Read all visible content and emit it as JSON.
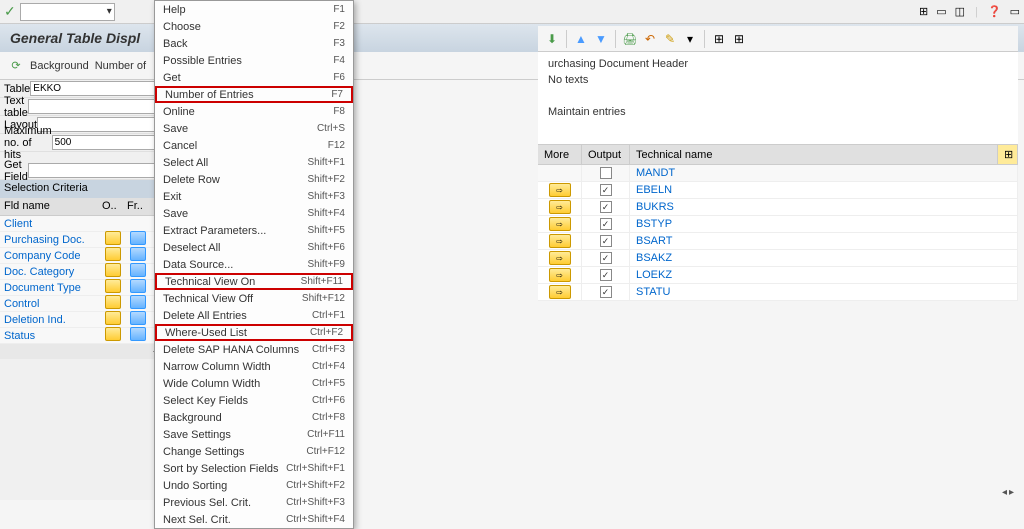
{
  "top": {
    "check": "✓"
  },
  "title": "General Table Displ",
  "sub_toolbar": {
    "icon": "⟳",
    "background": "Background",
    "num_entries": "Number of"
  },
  "left_form": {
    "table_label": "Table",
    "table_value": "EKKO",
    "texttable_label": "Text table",
    "texttable_value": "",
    "layout_label": "Layout",
    "layout_value": "",
    "maxhits_label": "Maximum no. of hits",
    "maxhits_value": "500",
    "getfield_label": "Get Field",
    "getfield_value": ""
  },
  "criteria": {
    "header": "Selection Criteria",
    "col_name": "Fld name",
    "col_o": "O..",
    "col_fr": "Fr..",
    "rows": [
      {
        "name": "Client"
      },
      {
        "name": "Purchasing Doc."
      },
      {
        "name": "Company Code"
      },
      {
        "name": "Doc. Category"
      },
      {
        "name": "Document Type"
      },
      {
        "name": "Control"
      },
      {
        "name": "Deletion Ind."
      },
      {
        "name": "Status"
      }
    ]
  },
  "menu": {
    "items": [
      {
        "label": "Help",
        "shortcut": "F1"
      },
      {
        "label": "Choose",
        "shortcut": "F2"
      },
      {
        "label": "Back",
        "shortcut": "F3"
      },
      {
        "label": "Possible Entries",
        "shortcut": "F4"
      },
      {
        "label": "Get",
        "shortcut": "F6"
      },
      {
        "label": "Number of Entries",
        "shortcut": "F7",
        "hl": true
      },
      {
        "label": "Online",
        "shortcut": "F8"
      },
      {
        "label": "Save",
        "shortcut": "Ctrl+S"
      },
      {
        "label": "Cancel",
        "shortcut": "F12"
      },
      {
        "label": "Select All",
        "shortcut": "Shift+F1"
      },
      {
        "label": "Delete Row",
        "shortcut": "Shift+F2"
      },
      {
        "label": "Exit",
        "shortcut": "Shift+F3"
      },
      {
        "label": "Save",
        "shortcut": "Shift+F4"
      },
      {
        "label": "Extract Parameters...",
        "shortcut": "Shift+F5"
      },
      {
        "label": "Deselect All",
        "shortcut": "Shift+F6"
      },
      {
        "label": "Data Source...",
        "shortcut": "Shift+F9"
      },
      {
        "label": "Technical View On",
        "shortcut": "Shift+F11",
        "hl": true
      },
      {
        "label": "Technical View Off",
        "shortcut": "Shift+F12"
      },
      {
        "label": "Delete All Entries",
        "shortcut": "Ctrl+F1"
      },
      {
        "label": "Where-Used List",
        "shortcut": "Ctrl+F2",
        "hl": true
      },
      {
        "label": "Delete SAP HANA Columns",
        "shortcut": "Ctrl+F3"
      },
      {
        "label": "Narrow Column Width",
        "shortcut": "Ctrl+F4"
      },
      {
        "label": "Wide Column Width",
        "shortcut": "Ctrl+F5"
      },
      {
        "label": "Select Key Fields",
        "shortcut": "Ctrl+F6"
      },
      {
        "label": "Background",
        "shortcut": "Ctrl+F8"
      },
      {
        "label": "Save Settings",
        "shortcut": "Ctrl+F11"
      },
      {
        "label": "Change Settings",
        "shortcut": "Ctrl+F12"
      },
      {
        "label": "Sort by Selection Fields",
        "shortcut": "Ctrl+Shift+F1"
      },
      {
        "label": "Undo Sorting",
        "shortcut": "Ctrl+Shift+F2"
      },
      {
        "label": "Previous Sel. Crit.",
        "shortcut": "Ctrl+Shift+F3"
      },
      {
        "label": "Next Sel. Crit.",
        "shortcut": "Ctrl+Shift+F4"
      }
    ]
  },
  "right": {
    "header_text": "urchasing Document Header",
    "no_texts": "No texts",
    "maintain": "Maintain entries",
    "cols": {
      "more": "More",
      "output": "Output",
      "tech": "Technical name"
    },
    "rows": [
      {
        "tech": "MANDT",
        "checked": false,
        "more": false
      },
      {
        "tech": "EBELN",
        "checked": true,
        "more": true
      },
      {
        "tech": "BUKRS",
        "checked": true,
        "more": true
      },
      {
        "tech": "BSTYP",
        "checked": true,
        "more": true
      },
      {
        "tech": "BSART",
        "checked": true,
        "more": true
      },
      {
        "tech": "BSAKZ",
        "checked": true,
        "more": true
      },
      {
        "tech": "LOEKZ",
        "checked": true,
        "more": true
      },
      {
        "tech": "STATU",
        "checked": true,
        "more": true
      }
    ]
  }
}
